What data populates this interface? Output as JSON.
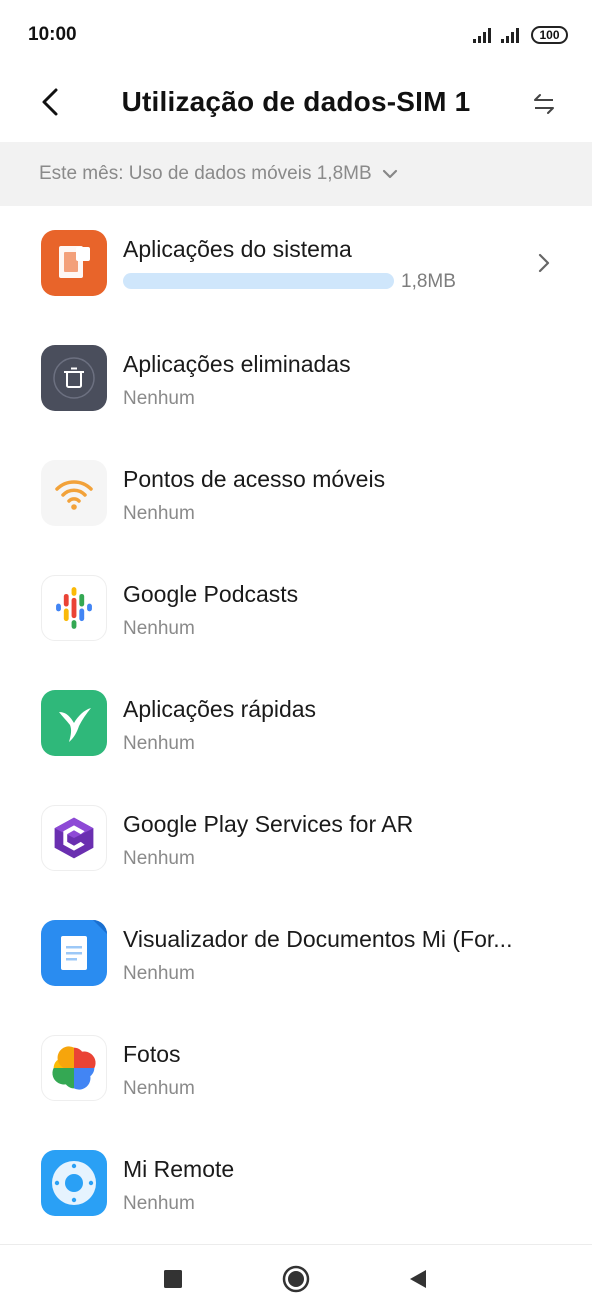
{
  "status_bar": {
    "time": "10:00",
    "battery": "100",
    "icons": [
      "signal-icon",
      "signal-icon",
      "battery-icon"
    ]
  },
  "header": {
    "title": "Utilização de dados-SIM 1",
    "back_icon": "back-arrow-icon",
    "switch_icon": "swap-arrows-icon"
  },
  "filter": {
    "label": "Este mês: Uso de dados móveis 1,8MB",
    "icon": "chevron-down-icon"
  },
  "apps": [
    {
      "name": "Aplicações do sistema",
      "usage": "1,8MB",
      "usage_fraction": 1.0,
      "icon": "system-apps-icon",
      "color": "#e8642a"
    },
    {
      "name": "Aplicações eliminadas",
      "usage": "Nenhum",
      "icon": "trash-icon",
      "color": "#4a4e5c"
    },
    {
      "name": "Pontos de acesso móveis",
      "usage": "Nenhum",
      "icon": "wifi-hotspot-icon",
      "color": "#f2a23a"
    },
    {
      "name": "Google Podcasts",
      "usage": "Nenhum",
      "icon": "google-podcasts-icon"
    },
    {
      "name": "Aplicações rápidas",
      "usage": "Nenhum",
      "icon": "hummingbird-icon",
      "color": "#2fb87a"
    },
    {
      "name": "Google Play Services for AR",
      "usage": "Nenhum",
      "icon": "arcore-icon",
      "color": "#6a2fb0"
    },
    {
      "name": "Visualizador de Documentos Mi (For...",
      "usage": "Nenhum",
      "icon": "document-viewer-icon",
      "color": "#2a8cf0"
    },
    {
      "name": "Fotos",
      "usage": "Nenhum",
      "icon": "google-photos-icon"
    },
    {
      "name": "Mi Remote",
      "usage": "Nenhum",
      "icon": "remote-icon",
      "color": "#2aa0f5"
    }
  ],
  "nav": {
    "icons": [
      "recents-square-icon",
      "home-circle-icon",
      "back-triangle-icon"
    ]
  }
}
